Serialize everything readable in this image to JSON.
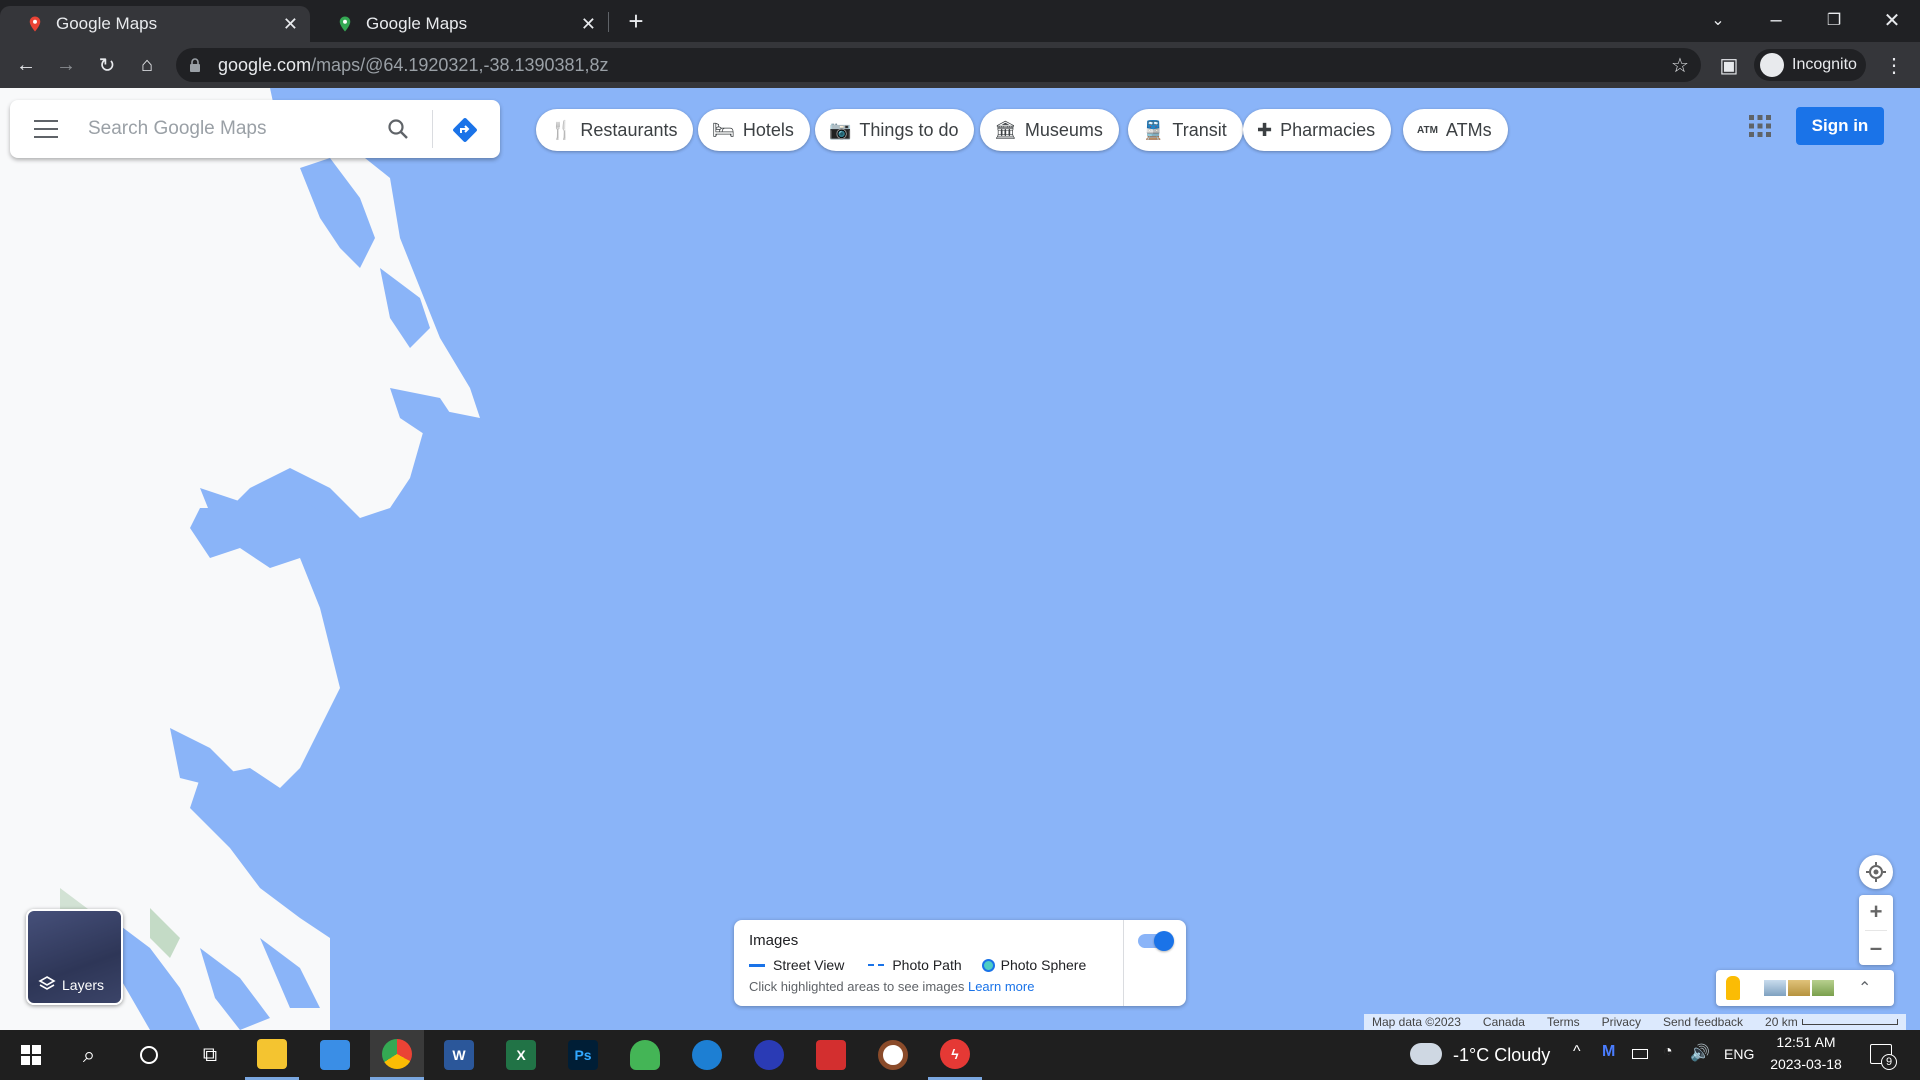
{
  "tabs": [
    {
      "title": "Google Maps",
      "active": true
    },
    {
      "title": "Google Maps",
      "active": false
    }
  ],
  "toolbar": {
    "url_host": "google.com",
    "url_path": "/maps/@64.1920321,-38.1390381,8z",
    "incognito_label": "Incognito"
  },
  "search": {
    "placeholder": "Search Google Maps"
  },
  "chips": [
    {
      "label": "Restaurants",
      "icon": "fork-knife-icon"
    },
    {
      "label": "Hotels",
      "icon": "bed-icon"
    },
    {
      "label": "Things to do",
      "icon": "camera-icon"
    },
    {
      "label": "Museums",
      "icon": "museum-icon"
    },
    {
      "label": "Transit",
      "icon": "train-icon"
    },
    {
      "label": "Pharmacies",
      "icon": "pharmacy-icon"
    },
    {
      "label": "ATMs",
      "icon": "atm-icon"
    }
  ],
  "signin_label": "Sign in",
  "layers_label": "Layers",
  "images_card": {
    "title": "Images",
    "legend": [
      {
        "label": "Street View",
        "color": "#1a73e8"
      },
      {
        "label": "Photo Path",
        "color": "#1a73e8"
      },
      {
        "label": "Photo Sphere",
        "color": "#4ecdc4"
      }
    ],
    "hint": "Click highlighted areas to see images",
    "learn_more": "Learn more",
    "toggle_on": true
  },
  "footer": {
    "map_data": "Map data ©2023",
    "country": "Canada",
    "terms": "Terms",
    "privacy": "Privacy",
    "feedback": "Send feedback",
    "scale": "20 km"
  },
  "taskbar": {
    "weather": "-1°C  Cloudy",
    "lang": "ENG",
    "time": "12:51 AM",
    "date": "2023-03-18",
    "notifications": "9"
  },
  "colors": {
    "water": "#8ab4f8",
    "land": "#f8f9fa",
    "accent": "#1a73e8"
  }
}
